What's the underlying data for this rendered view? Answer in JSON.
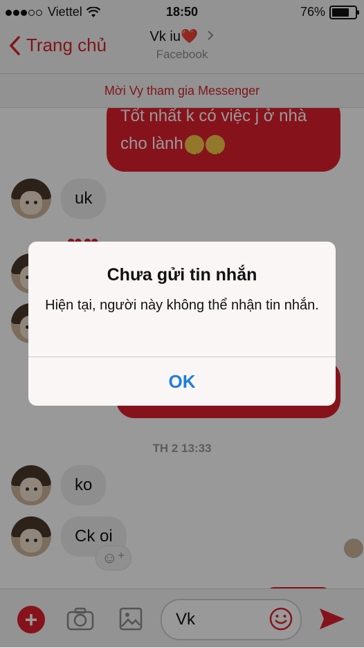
{
  "status_bar": {
    "carrier": "Viettel",
    "time": "18:50",
    "battery": "76%",
    "battery_level": 0.76
  },
  "nav": {
    "back_label": "Trang chủ",
    "title": "Vk iu❤️",
    "subtitle": "Facebook"
  },
  "invite_banner": "Mời Vy tham gia Messenger",
  "messages": {
    "out_1_line1": "Tốt nhất k có việc j ở nhà",
    "out_1_line2": "cho lành",
    "in_1": "uk",
    "timestamp": "TH 2 13:33",
    "in_2": "ko",
    "in_3": "Ck oi"
  },
  "composer": {
    "text": "Vk"
  },
  "alert": {
    "title": "Chưa gửi tin nhắn",
    "message": "Hiện tại, người này không thể nhận tin nhắn.",
    "ok_label": "OK"
  },
  "icons": {
    "back": "chevron-left-icon",
    "title_arrow": "chevron-right-icon",
    "wifi": "wifi-icon",
    "add": "plus-icon",
    "camera": "camera-icon",
    "photo": "image-icon",
    "emoji": "smiley-icon",
    "send": "send-icon"
  },
  "colors": {
    "accent": "#e0212e",
    "alert_button": "#1d7de0"
  }
}
